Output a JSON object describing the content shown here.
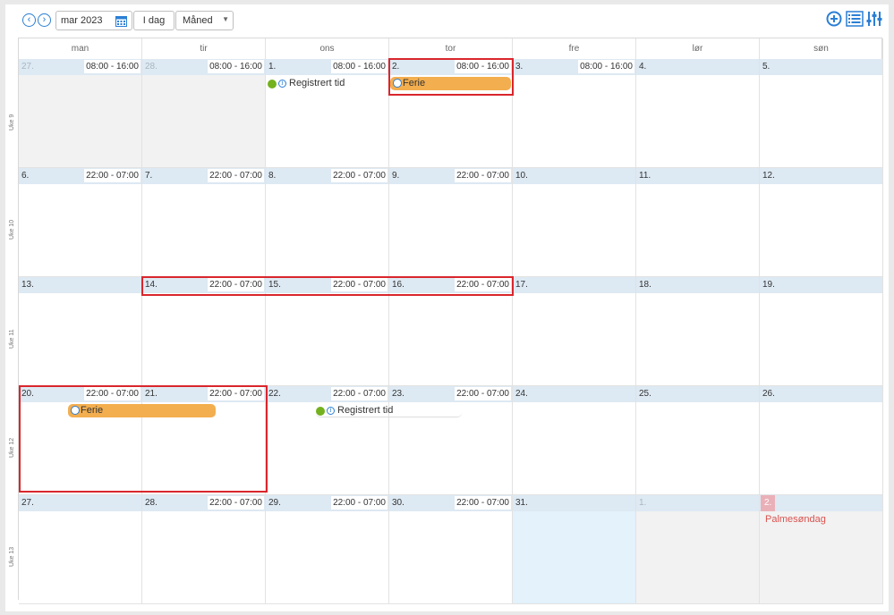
{
  "toolbar": {
    "prev_icon": "chevron-left-icon",
    "next_icon": "chevron-right-icon",
    "date_value": "mar 2023",
    "calendar_icon": "calendar-icon",
    "today_label": "I dag",
    "view_selected": "Måned",
    "add_icon": "plus-circle-icon",
    "list_icon": "list-icon",
    "filter_icon": "sliders-icon"
  },
  "weekdays": [
    "man",
    "tir",
    "ons",
    "tor",
    "fre",
    "lør",
    "søn"
  ],
  "weeks": [
    {
      "label": "Uke 9",
      "days": [
        {
          "num": "27.",
          "shift": "08:00 - 16:00",
          "other": true
        },
        {
          "num": "28.",
          "shift": "08:00 - 16:00",
          "other": true
        },
        {
          "num": "1.",
          "shift": "08:00 - 16:00"
        },
        {
          "num": "2.",
          "shift": "08:00 - 16:00"
        },
        {
          "num": "3.",
          "shift": "08:00 - 16:00"
        },
        {
          "num": "4.",
          "shift": ""
        },
        {
          "num": "5.",
          "shift": ""
        }
      ]
    },
    {
      "label": "Uke 10",
      "days": [
        {
          "num": "6.",
          "shift": "22:00 - 07:00"
        },
        {
          "num": "7.",
          "shift": "22:00 - 07:00"
        },
        {
          "num": "8.",
          "shift": "22:00 - 07:00"
        },
        {
          "num": "9.",
          "shift": "22:00 - 07:00"
        },
        {
          "num": "10.",
          "shift": ""
        },
        {
          "num": "11.",
          "shift": ""
        },
        {
          "num": "12.",
          "shift": ""
        }
      ]
    },
    {
      "label": "Uke 11",
      "days": [
        {
          "num": "13.",
          "shift": ""
        },
        {
          "num": "14.",
          "shift": "22:00 - 07:00"
        },
        {
          "num": "15.",
          "shift": "22:00 - 07:00"
        },
        {
          "num": "16.",
          "shift": "22:00 - 07:00"
        },
        {
          "num": "17.",
          "shift": ""
        },
        {
          "num": "18.",
          "shift": ""
        },
        {
          "num": "19.",
          "shift": ""
        }
      ]
    },
    {
      "label": "Uke 12",
      "days": [
        {
          "num": "20.",
          "shift": "22:00 - 07:00"
        },
        {
          "num": "21.",
          "shift": "22:00 - 07:00"
        },
        {
          "num": "22.",
          "shift": "22:00 - 07:00"
        },
        {
          "num": "23.",
          "shift": "22:00 - 07:00"
        },
        {
          "num": "24.",
          "shift": ""
        },
        {
          "num": "25.",
          "shift": ""
        },
        {
          "num": "26.",
          "shift": ""
        }
      ]
    },
    {
      "label": "Uke 13",
      "days": [
        {
          "num": "27.",
          "shift": ""
        },
        {
          "num": "28.",
          "shift": "22:00 - 07:00"
        },
        {
          "num": "29.",
          "shift": "22:00 - 07:00"
        },
        {
          "num": "30.",
          "shift": "22:00 - 07:00"
        },
        {
          "num": "31.",
          "shift": "",
          "today": true
        },
        {
          "num": "1.",
          "shift": "",
          "other": true
        },
        {
          "num": "2.",
          "shift": "",
          "other": true,
          "holiday": "Palmesøndag"
        }
      ]
    }
  ],
  "events": [
    {
      "type": "registered",
      "label": "Registrert tid",
      "week": 0,
      "day": 2,
      "span": 1
    },
    {
      "type": "vacation",
      "label": "Ferie",
      "week": 0,
      "day": 3,
      "span": 1
    },
    {
      "type": "vacation",
      "label": "Ferie",
      "week": 3,
      "day": 0,
      "span": 2
    },
    {
      "type": "registered",
      "label": "Registrert tid",
      "week": 3,
      "day": 2,
      "span": 2
    }
  ],
  "colors": {
    "accent": "#2b7fd4",
    "vacation": "#f3ae4f",
    "registered_dot": "#74b11e",
    "highlight": "#d9262c",
    "holiday": "#d9534f"
  }
}
